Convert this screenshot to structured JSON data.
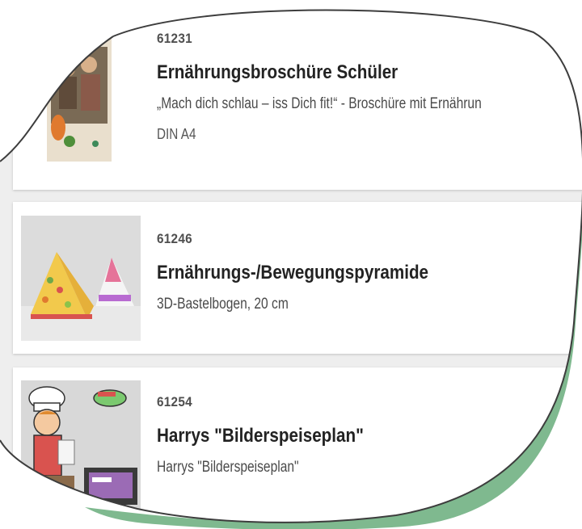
{
  "products": [
    {
      "article_number": "61231",
      "title": "Ernährungsbroschüre Schüler",
      "description": "„Mach dich schlau – iss Dich fit!“ - Broschüre mit Ernährun",
      "format": "DIN A4",
      "thumbnail_icon": "brochure-cover-image"
    },
    {
      "article_number": "61246",
      "title": "Ernährungs-/Bewegungspyramide",
      "description": "3D-Bastelbogen, 20 cm",
      "thumbnail_icon": "pyramid-craft-image"
    },
    {
      "article_number": "61254",
      "title": "Harrys \"Bilderspeiseplan\"",
      "description": "Harrys \"Bilderspeiseplan\"",
      "thumbnail_icon": "cartoon-chef-image"
    }
  ],
  "colors": {
    "frame_green": "#7fb98f",
    "frame_outline": "#3d3d3d",
    "card_background": "#ffffff",
    "page_background": "#eeeeee"
  }
}
